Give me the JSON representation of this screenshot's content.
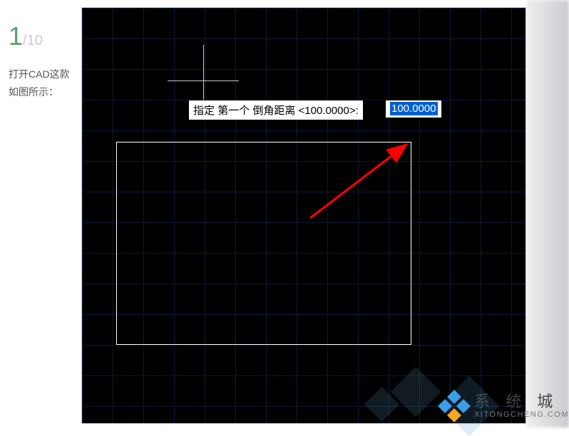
{
  "sidebar": {
    "step_current": "1",
    "step_total": "/10",
    "instruction_line1": "打开CAD这款",
    "instruction_line2": "如图所示："
  },
  "cad": {
    "prompt_label": "指定 第一个 倒角距离 <100.0000>:",
    "input_value": "100.0000"
  },
  "watermark": {
    "cn": "系 统 城",
    "en": "XITONGCHENG.COM"
  }
}
